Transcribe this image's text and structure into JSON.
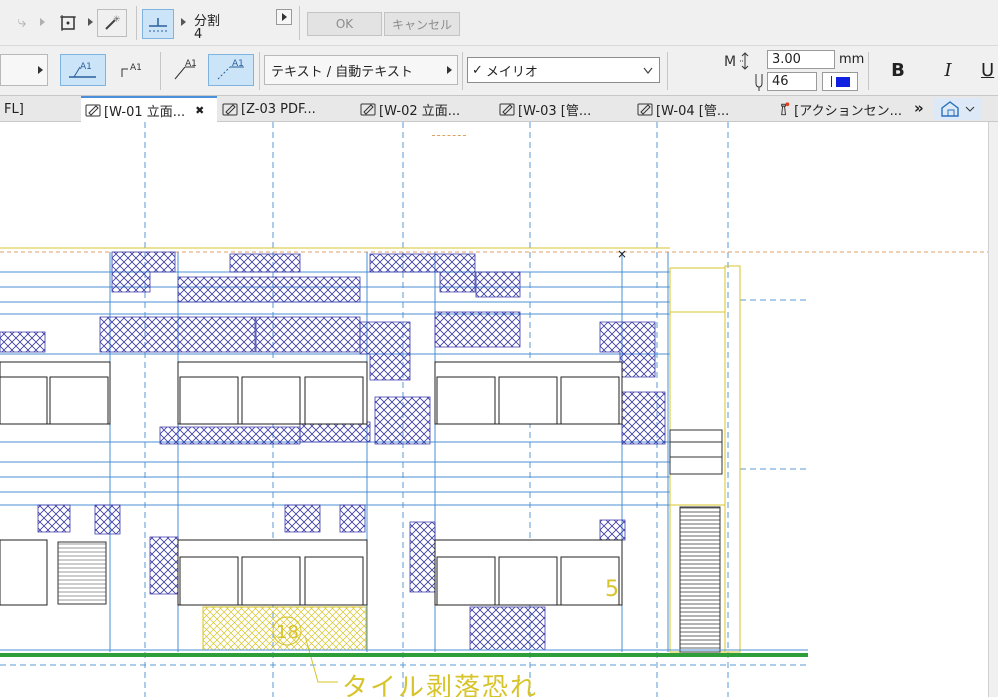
{
  "toolbar1": {
    "division_label": "分割",
    "division_value": "4",
    "ok_label": "OK",
    "cancel_label": "キャンセル"
  },
  "toolbar2": {
    "text_type": "テキスト / 自動テキスト",
    "font_name": "メイリオ",
    "font_check": "✓",
    "size_value": "3.00",
    "size_unit": "mm",
    "pen_value": "46",
    "bold_label": "B",
    "italic_label": "I",
    "underline_label": "U"
  },
  "tabs": [
    {
      "label": "FL]"
    },
    {
      "label": "[W-01 立面...",
      "close": "✖",
      "active": true
    },
    {
      "label": "[Z-03 PDF..."
    },
    {
      "label": "[W-02 立面..."
    },
    {
      "label": "[W-03 [管..."
    },
    {
      "label": "[W-04 [管..."
    },
    {
      "label": "[アクションセン..."
    }
  ],
  "tabs_more": "»",
  "drawing": {
    "annotation_text": "タイル剥落恐れ",
    "marker_18": "18",
    "marker_5": "5"
  },
  "colors": {
    "blue_line": "#4a8fd6",
    "hatch": "#3a3aa8",
    "yellow": "#d7c42a",
    "green": "#2e9e3b",
    "accent_bg": "#cce4f7"
  }
}
